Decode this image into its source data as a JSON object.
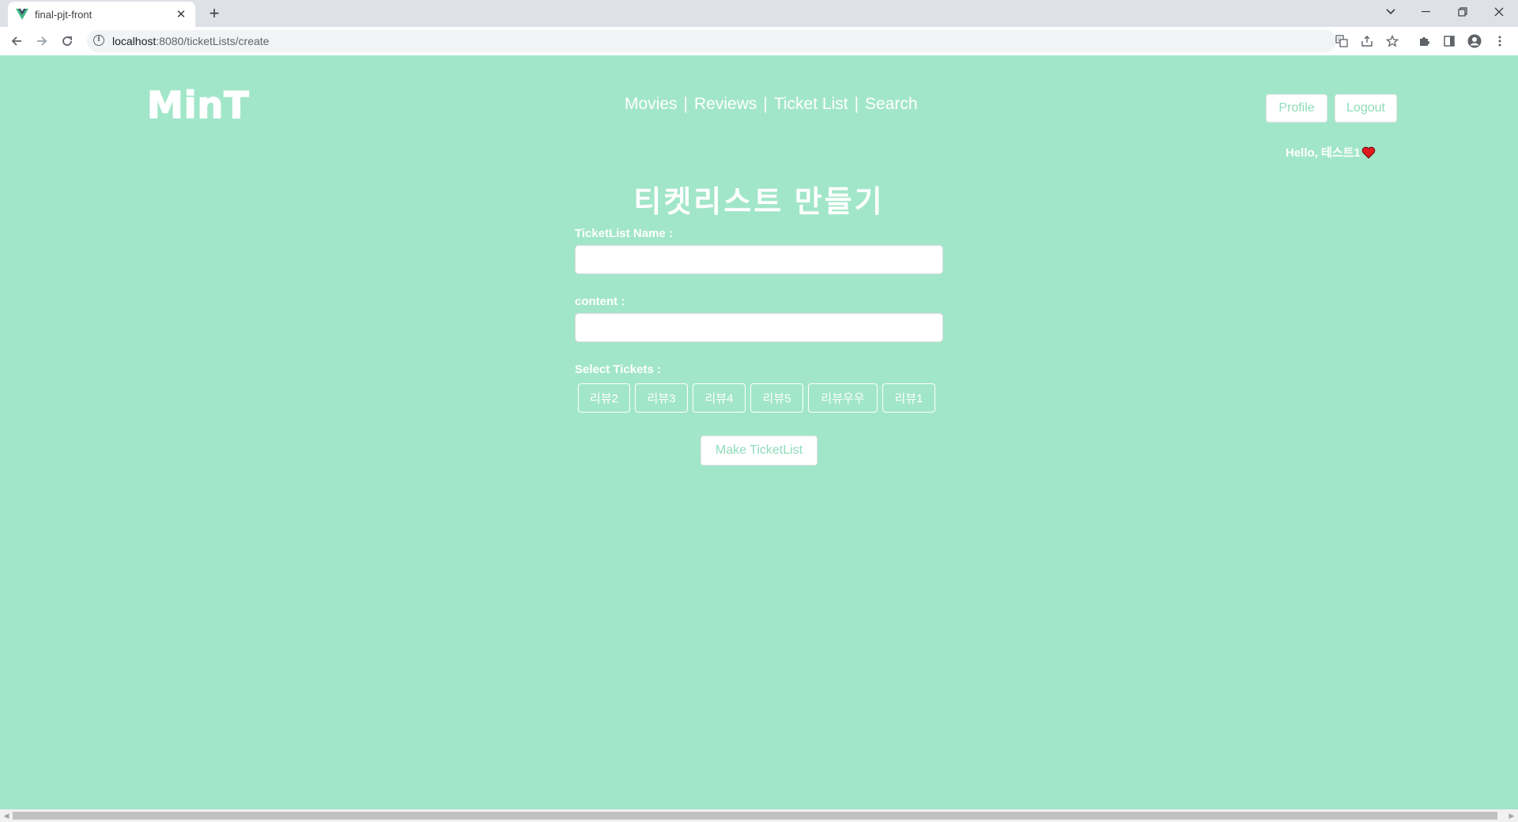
{
  "browser": {
    "tab_title": "final-pjt-front",
    "url_host": "localhost",
    "url_path": ":8080/ticketLists/create"
  },
  "header": {
    "logo": "MinT",
    "nav": [
      "Movies",
      "Reviews",
      "Ticket List",
      "Search"
    ],
    "separator": "|",
    "profile_label": "Profile",
    "logout_label": "Logout",
    "greeting": "Hello, 테스트1"
  },
  "form": {
    "title": "티켓리스트 만들기",
    "name_label": "TicketList Name :",
    "name_value": "",
    "content_label": "content :",
    "content_value": "",
    "tickets_label": "Select Tickets :",
    "tickets": [
      "리뷰2",
      "리뷰3",
      "리뷰4",
      "리뷰5",
      "리뷰우우",
      "리뷰1"
    ],
    "submit_label": "Make TicketList"
  },
  "colors": {
    "background": "#a2e6c9",
    "accent_text": "#8fdcbc",
    "white": "#ffffff"
  }
}
